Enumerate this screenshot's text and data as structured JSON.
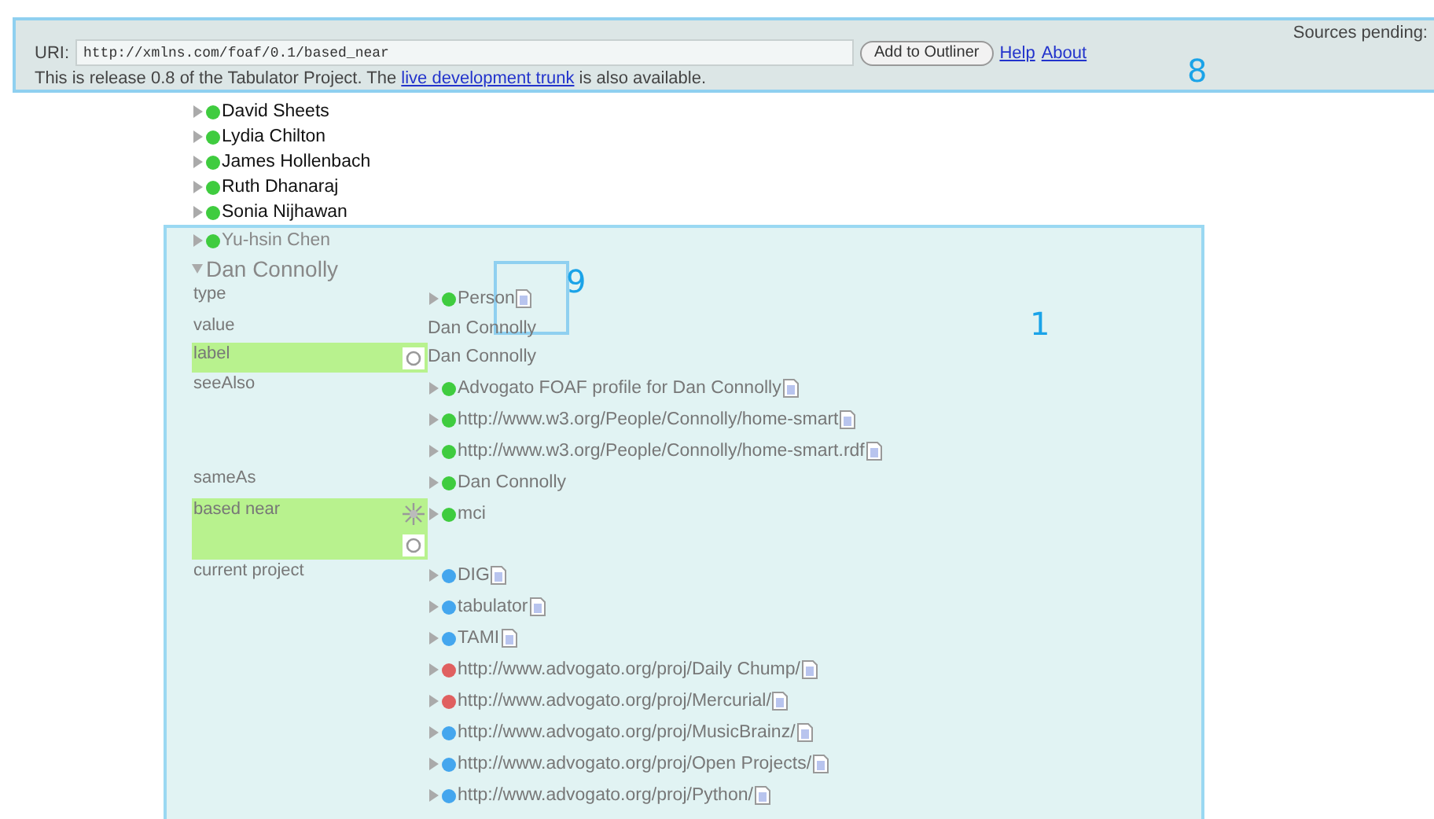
{
  "header": {
    "uri_label": "URI:",
    "uri_value": "http://xmlns.com/foaf/0.1/based_near",
    "add_button": "Add to Outliner",
    "links": [
      "Help",
      "About"
    ],
    "release_before": "This is release 0.8 of the Tabulator Project. The ",
    "release_link": "live development trunk",
    "release_after": " is also available.",
    "sources": "Sources pending:",
    "annotation": "8"
  },
  "people": [
    {
      "name": "David Sheets",
      "color": "#3fcc3f"
    },
    {
      "name": "Lydia Chilton",
      "color": "#3fcc3f"
    },
    {
      "name": "James Hollenbach",
      "color": "#3fcc3f"
    },
    {
      "name": "Ruth Dhanaraj",
      "color": "#3fcc3f"
    },
    {
      "name": "Sonia Nijhawan",
      "color": "#3fcc3f"
    }
  ],
  "panel": {
    "annotation": "1",
    "first": {
      "name": "Yu-hsin Chen",
      "color": "#3fcc3f"
    },
    "title": "Dan Connolly",
    "expanded": true,
    "doc_annotation": "9",
    "properties": [
      {
        "label": "type",
        "selected": false,
        "values": [
          {
            "kind": "node",
            "text": "Person",
            "color": "#3fcc3f",
            "doc": true
          }
        ]
      },
      {
        "label": "value",
        "selected": false,
        "values": [
          {
            "kind": "literal",
            "text": "Dan Connolly"
          }
        ]
      },
      {
        "label": "label",
        "selected": true,
        "refreshable": true,
        "values": [
          {
            "kind": "literal",
            "text": "Dan Connolly"
          }
        ]
      },
      {
        "label": "seeAlso",
        "selected": false,
        "values": [
          {
            "kind": "node",
            "text": "Advogato FOAF profile for Dan Connolly",
            "color": "#3fcc3f",
            "doc": true
          },
          {
            "kind": "node",
            "text": "http://www.w3.org/People/Connolly/home-smart",
            "color": "#3fcc3f",
            "doc": true
          },
          {
            "kind": "node",
            "text": "http://www.w3.org/People/Connolly/home-smart.rdf",
            "color": "#3fcc3f",
            "doc": true
          }
        ]
      },
      {
        "label": "sameAs",
        "selected": false,
        "values": [
          {
            "kind": "node",
            "text": "Dan Connolly",
            "color": "#3fcc3f",
            "doc": false
          }
        ]
      },
      {
        "label": "based near",
        "selected": true,
        "locatable": true,
        "refreshable": true,
        "values": [
          {
            "kind": "node",
            "text": "mci",
            "color": "#3fcc3f",
            "doc": false
          }
        ]
      },
      {
        "label": "current project",
        "selected": false,
        "values": [
          {
            "kind": "node",
            "text": "DIG",
            "color": "#44a6ee",
            "doc": true
          },
          {
            "kind": "node",
            "text": "tabulator",
            "color": "#44a6ee",
            "doc": true
          },
          {
            "kind": "node",
            "text": "TAMI",
            "color": "#44a6ee",
            "doc": true
          },
          {
            "kind": "node",
            "text": "http://www.advogato.org/proj/Daily Chump/",
            "color": "#e06060",
            "doc": true
          },
          {
            "kind": "node",
            "text": "http://www.advogato.org/proj/Mercurial/",
            "color": "#e06060",
            "doc": true
          },
          {
            "kind": "node",
            "text": "http://www.advogato.org/proj/MusicBrainz/",
            "color": "#44a6ee",
            "doc": true
          },
          {
            "kind": "node",
            "text": "http://www.advogato.org/proj/Open Projects/",
            "color": "#44a6ee",
            "doc": true
          },
          {
            "kind": "node",
            "text": "http://www.advogato.org/proj/Python/",
            "color": "#44a6ee",
            "doc": true
          }
        ]
      }
    ]
  }
}
